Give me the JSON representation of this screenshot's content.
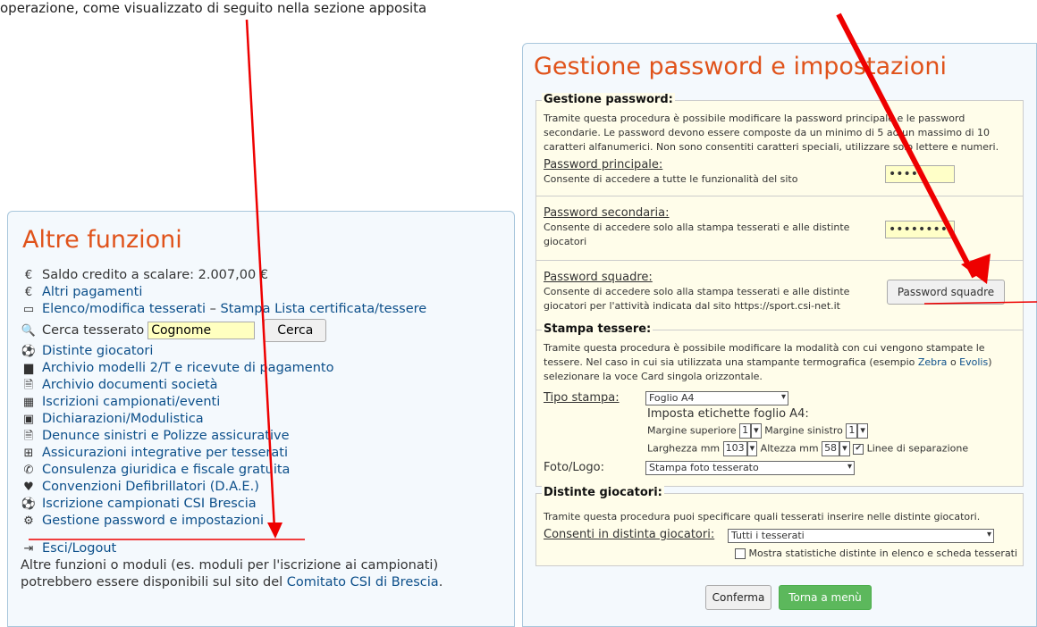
{
  "top_text": "operazione, come visualizzato di seguito nella sezione apposita",
  "left": {
    "title": "Altre funzioni",
    "saldo": "Saldo credito a scalare: 2.007,00 €",
    "altri_pagamenti": "Altri pagamenti",
    "elenco": "Elenco/modifica tesserati",
    "stampa_lista": "Stampa Lista certificata/tessere",
    "cerca_label": "Cerca tesserato",
    "cerca_value": "Cognome",
    "cerca_button": "Cerca",
    "links": [
      {
        "icon": "⚽",
        "label": "Distinte giocatori"
      },
      {
        "icon": "▆",
        "label": "Archivio modelli 2/T e ricevute di pagamento"
      },
      {
        "icon": "🗎",
        "label": "Archivio documenti società"
      },
      {
        "icon": "▦",
        "label": "Iscrizioni campionati/eventi"
      },
      {
        "icon": "▣",
        "label": "Dichiarazioni/Modulistica"
      },
      {
        "icon": "🗎",
        "label": "Denunce sinistri e Polizze assicurative"
      },
      {
        "icon": "⊞",
        "label": "Assicurazioni integrative per tesserati"
      },
      {
        "icon": "✆",
        "label": "Consulenza giuridica e fiscale gratuita"
      },
      {
        "icon": "♥",
        "label": "Convenzioni Defibrillatori (D.A.E.)"
      },
      {
        "icon": "⚽",
        "label": "Iscrizione campionati CSI Brescia"
      },
      {
        "icon": "⚙",
        "label": "Gestione password e impostazioni"
      }
    ],
    "logout": "Esci/Logout",
    "footer_text": "Altre funzioni o moduli (es. moduli per l'iscrizione ai campionati) potrebbero essere disponibili sul sito del",
    "footer_link": "Comitato CSI di Brescia",
    "footer_end": "."
  },
  "right": {
    "title": "Gestione password e impostazioni",
    "pw_section": {
      "legend": "Gestione password:",
      "intro": "Tramite questa procedura è possibile modificare la password principale e le password secondarie. Le password devono essere composte da un minimo di 5 ad un massimo di 10 caratteri alfanumerici. Non sono consentiti caratteri speciali, utilizzare solo lettere e numeri.",
      "principale_label": "Password principale:",
      "principale_desc": "Consente di accedere a tutte le funzionalità del sito",
      "principale_value": "••••",
      "secondaria_label": "Password secondaria:",
      "secondaria_desc": "Consente di accedere solo alla stampa tesserati e alle distinte giocatori",
      "secondaria_value": "••••••••",
      "squadre_label": "Password squadre:",
      "squadre_desc": "Consente di accedere solo alla stampa tesserati e alle distinte giocatori per l'attività indicata dal sito https://sport.csi-net.it",
      "squadre_button": "Password squadre"
    },
    "stampa_section": {
      "legend": "Stampa tessere:",
      "intro_1": "Tramite questa procedura è possibile modificare la modalità con cui vengono stampate le tessere. Nel caso in cui sia utilizzata una stampante termografica (esempio",
      "zebra": "Zebra",
      "o": "o",
      "evolis": "Evolis",
      "intro_2": ") selezionare la voce Card singola orizzontale.",
      "tipo_label": "Tipo stampa:",
      "tipo_value": "Foglio A4",
      "imposta": "Imposta etichette foglio A4:",
      "margine_sup_label": "Margine superiore",
      "margine_sup_value": "1",
      "margine_sin_label": "Margine sinistro",
      "margine_sin_value": "1",
      "larghezza_label": "Larghezza mm",
      "larghezza_value": "103",
      "altezza_label": "Altezza mm",
      "altezza_value": "58",
      "linee_label": "Linee di separazione",
      "foto_label": "Foto/Logo:",
      "foto_value": "Stampa foto tesserato"
    },
    "distinte_section": {
      "legend": "Distinte giocatori:",
      "intro": "Tramite questa procedura puoi specificare quali tesserati inserire nelle distinte giocatori.",
      "consenti_label": "Consenti in distinta giocatori:",
      "consenti_value": "Tutti i tesserati",
      "mostra_label": "Mostra statistiche distinte in elenco e scheda tesserati"
    },
    "conferma": "Conferma",
    "torna": "Torna a menù"
  },
  "colors": {
    "title": "#e0531b",
    "link": "#0c4f8a",
    "arrow": "#ee0000",
    "green": "#5cb85c"
  }
}
